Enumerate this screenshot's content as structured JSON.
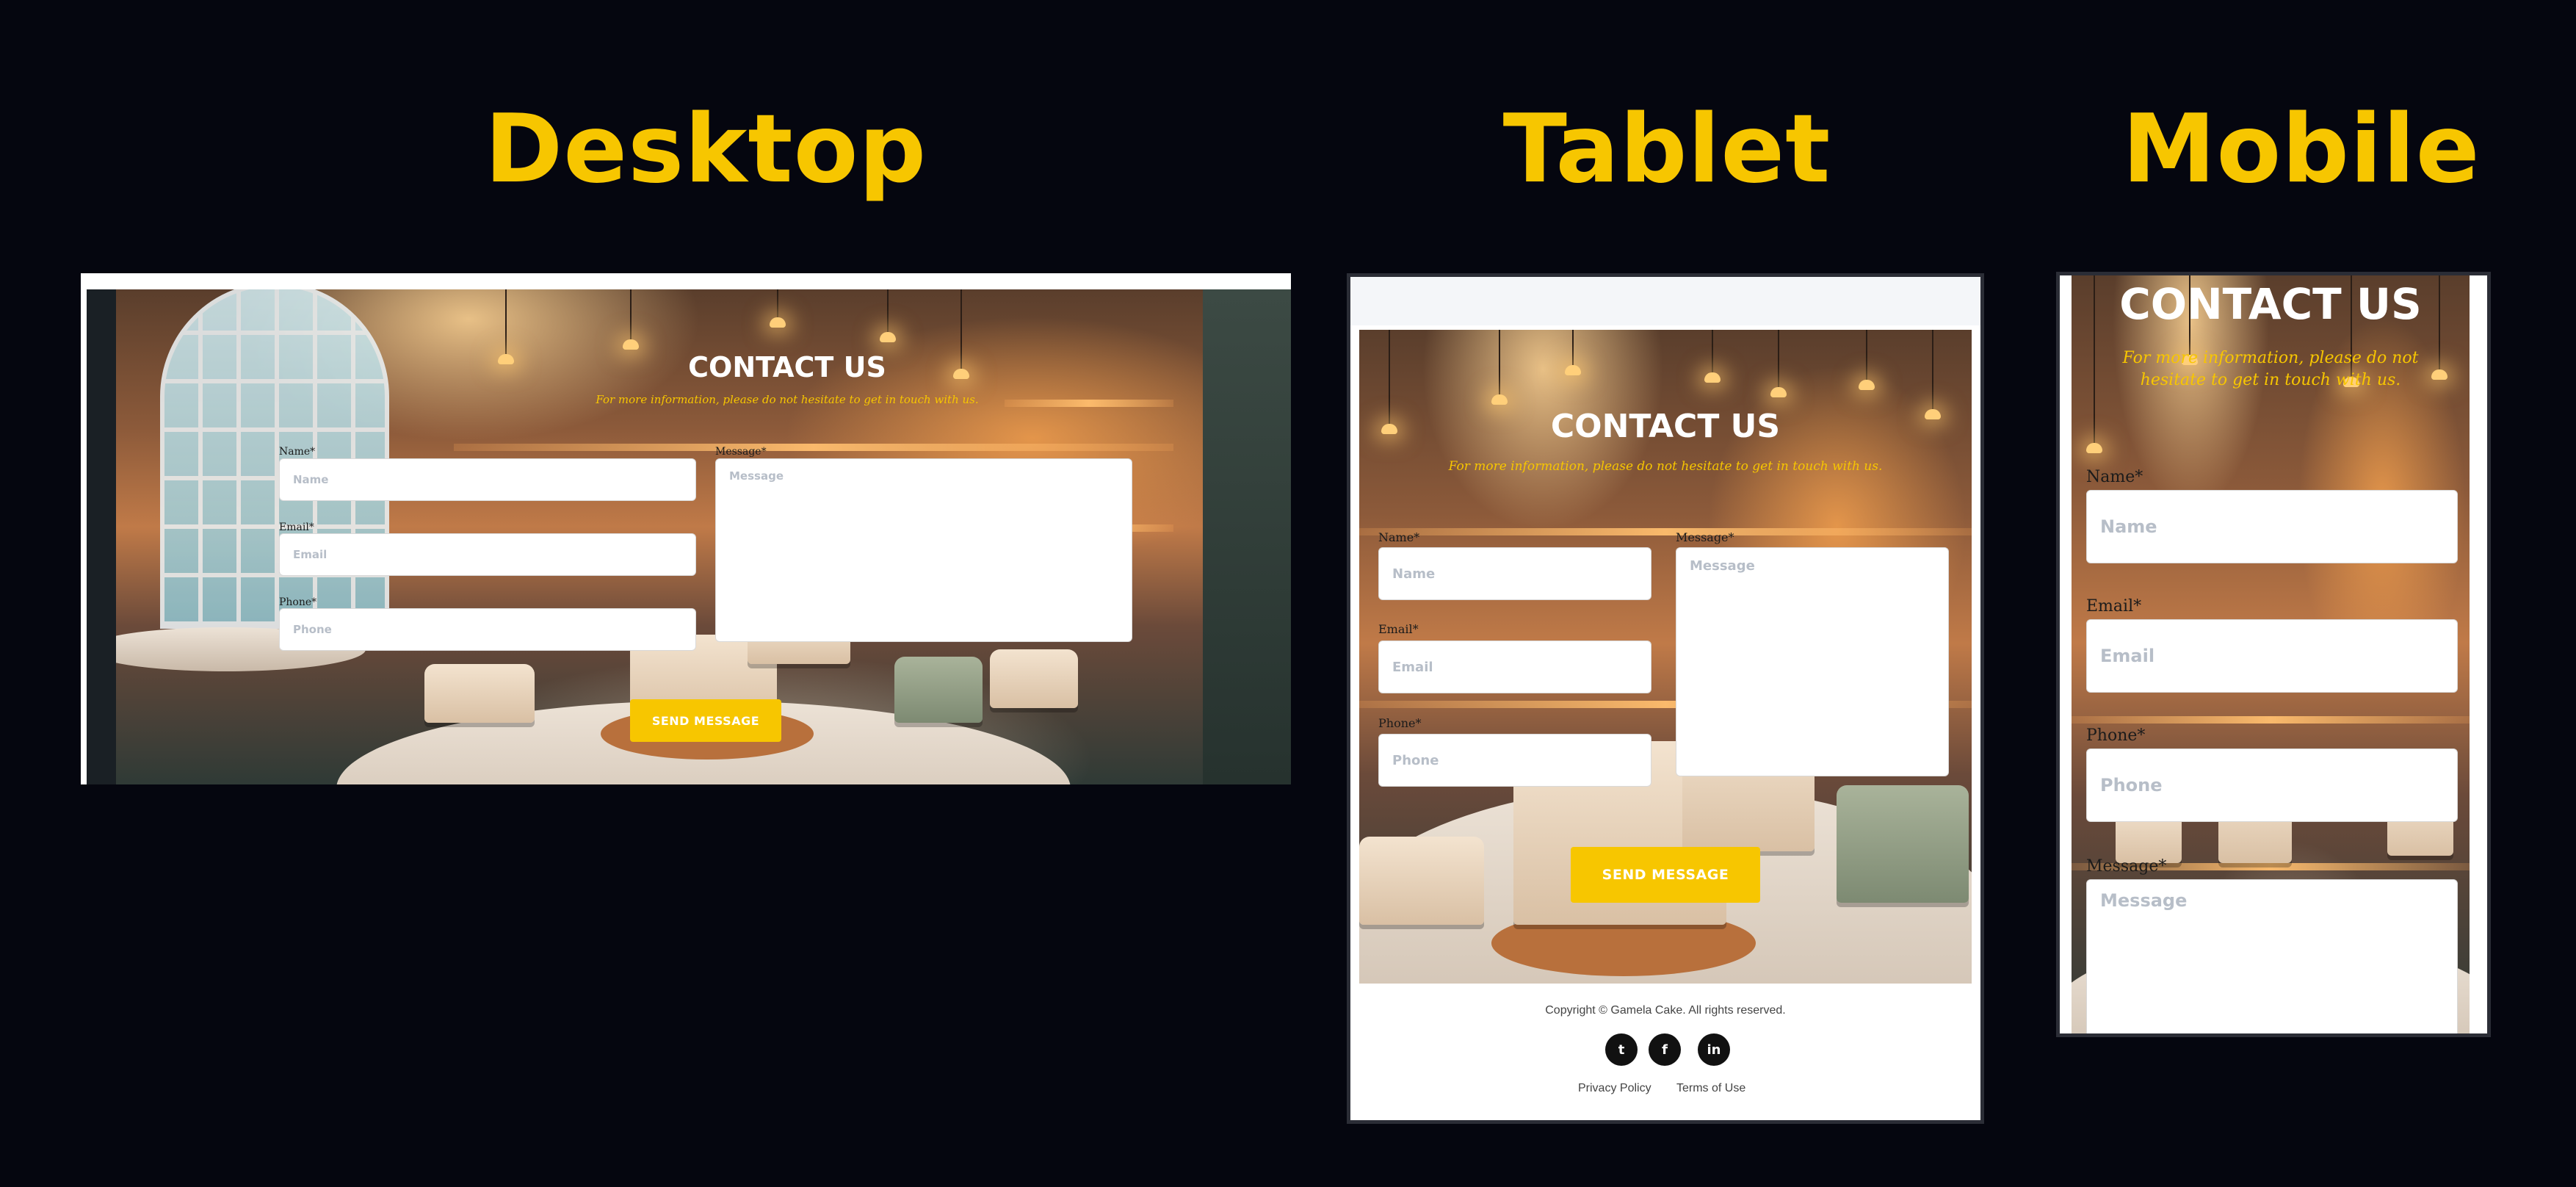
{
  "columns": {
    "desktop": "Desktop",
    "tablet": "Tablet",
    "mobile": "Mobile"
  },
  "contact": {
    "title": "CONTACT US",
    "subtitle": "For more information, please do not hesitate to get in touch with us.",
    "fields": {
      "name": {
        "label": "Name*",
        "placeholder": "Name"
      },
      "email": {
        "label": "Email*",
        "placeholder": "Email"
      },
      "phone": {
        "label": "Phone*",
        "placeholder": "Phone"
      },
      "message": {
        "label": "Message*",
        "placeholder": "Message"
      }
    },
    "send_label": "SEND MESSAGE"
  },
  "footer": {
    "copyright": "Copyright © Gamela Cake. All rights reserved.",
    "social": [
      {
        "name": "twitter-icon",
        "glyph": "t"
      },
      {
        "name": "facebook-icon",
        "glyph": "f"
      },
      {
        "name": "linkedin-icon",
        "glyph": "in"
      }
    ],
    "links": [
      "Privacy Policy",
      "Terms of Use"
    ]
  },
  "colors": {
    "background": "#05060f",
    "accent": "#f7c600",
    "frame_border": "#2b2d36"
  }
}
